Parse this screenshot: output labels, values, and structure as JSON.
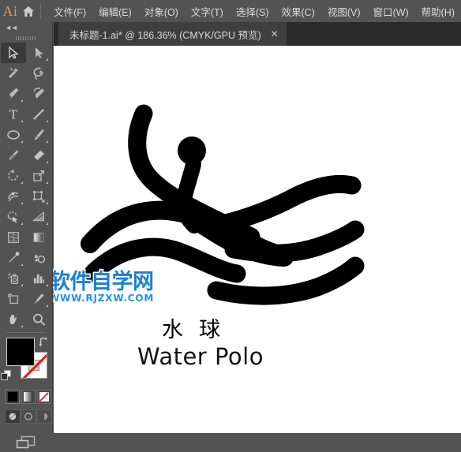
{
  "app": {
    "logo_text": "Ai",
    "home_icon": "home-icon"
  },
  "menubar": {
    "items": [
      {
        "label": "文件(F)",
        "name": "menu-file"
      },
      {
        "label": "编辑(E)",
        "name": "menu-edit"
      },
      {
        "label": "对象(O)",
        "name": "menu-object"
      },
      {
        "label": "文字(T)",
        "name": "menu-type"
      },
      {
        "label": "选择(S)",
        "name": "menu-select"
      },
      {
        "label": "效果(C)",
        "name": "menu-effect"
      },
      {
        "label": "视图(V)",
        "name": "menu-view"
      },
      {
        "label": "窗口(W)",
        "name": "menu-window"
      },
      {
        "label": "帮助(H)",
        "name": "menu-help"
      }
    ]
  },
  "tabs": {
    "active_tab_title": "未标题-1.ai* @ 186.36% (CMYK/GPU 预览)",
    "close_glyph": "✕"
  },
  "toolbar": {
    "collapse_glyph": "◄◄",
    "tools": [
      {
        "label": "选择工具",
        "icon": "selection-arrow-icon",
        "active": true,
        "has_more": false
      },
      {
        "label": "直接选择工具",
        "icon": "direct-selection-arrow-icon",
        "active": false,
        "has_more": true
      },
      {
        "label": "魔棒工具",
        "icon": "magic-wand-icon",
        "active": false,
        "has_more": false
      },
      {
        "label": "套索工具",
        "icon": "lasso-icon",
        "active": false,
        "has_more": false
      },
      {
        "label": "钢笔工具",
        "icon": "pen-icon",
        "active": false,
        "has_more": true
      },
      {
        "label": "曲率工具",
        "icon": "curvature-pen-icon",
        "active": false,
        "has_more": false
      },
      {
        "label": "文字工具",
        "icon": "type-icon",
        "active": false,
        "has_more": true
      },
      {
        "label": "直线段工具",
        "icon": "line-segment-icon",
        "active": false,
        "has_more": true
      },
      {
        "label": "椭圆工具",
        "icon": "ellipse-icon",
        "active": false,
        "has_more": true
      },
      {
        "label": "画笔工具",
        "icon": "paintbrush-icon",
        "active": false,
        "has_more": true
      },
      {
        "label": "斑点画笔工具",
        "icon": "blob-brush-icon",
        "active": false,
        "has_more": false
      },
      {
        "label": "橡皮擦工具",
        "icon": "eraser-icon",
        "active": false,
        "has_more": true
      },
      {
        "label": "旋转工具",
        "icon": "rotate-icon",
        "active": false,
        "has_more": true
      },
      {
        "label": "缩放工具",
        "icon": "scale-icon",
        "active": false,
        "has_more": true
      },
      {
        "label": "宽度工具",
        "icon": "width-tool-icon",
        "active": false,
        "has_more": true
      },
      {
        "label": "自由变换工具",
        "icon": "free-transform-icon",
        "active": false,
        "has_more": true
      },
      {
        "label": "形状生成器工具",
        "icon": "shape-builder-icon",
        "active": false,
        "has_more": true
      },
      {
        "label": "透视网格工具",
        "icon": "perspective-grid-icon",
        "active": false,
        "has_more": true
      },
      {
        "label": "网格工具",
        "icon": "mesh-icon",
        "active": false,
        "has_more": false
      },
      {
        "label": "渐变工具",
        "icon": "gradient-icon",
        "active": false,
        "has_more": false
      },
      {
        "label": "吸管工具",
        "icon": "eyedropper-icon",
        "active": false,
        "has_more": true
      },
      {
        "label": "混合工具",
        "icon": "blend-icon",
        "active": false,
        "has_more": false
      },
      {
        "label": "符号喷枪工具",
        "icon": "symbol-sprayer-icon",
        "active": false,
        "has_more": true
      },
      {
        "label": "柱形图工具",
        "icon": "column-graph-icon",
        "active": false,
        "has_more": true
      },
      {
        "label": "画板工具",
        "icon": "artboard-icon",
        "active": false,
        "has_more": false
      },
      {
        "label": "切片工具",
        "icon": "slice-icon",
        "active": false,
        "has_more": true
      },
      {
        "label": "抓手工具",
        "icon": "hand-icon",
        "active": false,
        "has_more": true
      },
      {
        "label": "缩放显示工具",
        "icon": "zoom-magnifier-icon",
        "active": false,
        "has_more": false
      }
    ],
    "color": {
      "fill_label": "填色",
      "fill_color": "#000000",
      "stroke_label": "描边",
      "stroke_color": "无",
      "swap_label": "互换填色和描边",
      "default_label": "默认填色和描边"
    },
    "paint_modes": [
      {
        "label": "颜色",
        "icon": "color-swatch-icon",
        "selected": true
      },
      {
        "label": "渐变",
        "icon": "gradient-swatch-icon",
        "selected": false
      },
      {
        "label": "无",
        "icon": "none-swatch-icon",
        "selected": false
      }
    ],
    "draw_modes": [
      {
        "label": "正常绘图",
        "icon": "draw-normal-icon",
        "selected": true
      },
      {
        "label": "背面绘图",
        "icon": "draw-behind-icon",
        "selected": false
      },
      {
        "label": "内部绘图",
        "icon": "draw-inside-icon",
        "selected": false
      }
    ],
    "screen_mode": {
      "label": "更改屏幕模式",
      "icon": "screen-mode-icon"
    }
  },
  "canvas": {
    "background": "#ffffff",
    "artwork": {
      "pictogram_name": "water-polo-pictogram",
      "pictogram_color": "#000000",
      "text_cn": "水  球",
      "text_en": "Water Polo"
    }
  },
  "watermark": {
    "main": "软件自学网",
    "sub": "WWW.RJZXW.COM",
    "color": "#1b7fd4"
  }
}
